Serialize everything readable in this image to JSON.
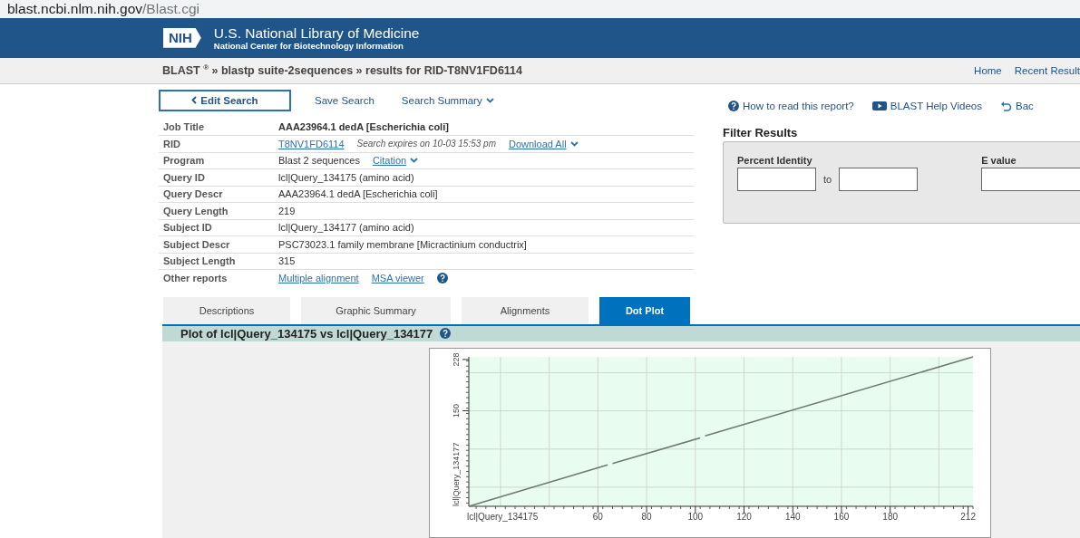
{
  "address_bar": {
    "host": "blast.ncbi.nlm.nih.gov",
    "path": "/Blast.cgi"
  },
  "banner": {
    "logo": "NIH",
    "title": "U.S. National Library of Medicine",
    "subtitle": "National Center for Biotechnology Information"
  },
  "breadcrumb": "BLAST $^{®}$ » blastp suite-2sequences » results for RID-T8NV1FD6114",
  "nav_links": [
    "Home",
    "Recent Result"
  ],
  "actions": [
    {
      "label": "Edit Search",
      "kind": "primary"
    },
    {
      "label": "Save Search",
      "kind": "link"
    },
    {
      "label": "Search Summary",
      "kind": "dropdown"
    }
  ],
  "help_links": [
    {
      "label": "How to read this report?",
      "kind": "help"
    },
    {
      "label": "BLAST Help Videos",
      "kind": "video"
    },
    {
      "label": "Bac",
      "kind": "back"
    }
  ],
  "summary": [
    {
      "label": "Job Title",
      "cells": [
        {
          "text": "AAA23964.1 dedA [Escherichia coli]",
          "kind": "bold"
        }
      ]
    },
    {
      "label": "RID",
      "cells": [
        {
          "text": "T8NV1FD6114",
          "kind": "link"
        },
        {
          "text": "Search expires on 10-03 15:53 pm",
          "kind": "note"
        },
        {
          "text": "Download All",
          "kind": "dropdown"
        }
      ]
    },
    {
      "label": "Program",
      "cells": [
        {
          "text": "Blast 2 sequences",
          "kind": "text"
        },
        {
          "text": "Citation",
          "kind": "dropdown"
        }
      ]
    },
    {
      "label": "Query ID",
      "cells": [
        {
          "text": "lcl|Query_134175 (amino acid)",
          "kind": "text"
        }
      ]
    },
    {
      "label": "Query Descr",
      "cells": [
        {
          "text": "AAA23964.1 dedA [Escherichia coli]",
          "kind": "text"
        }
      ]
    },
    {
      "label": "Query Length",
      "cells": [
        {
          "text": "219",
          "kind": "text"
        }
      ]
    },
    {
      "label": "Subject ID",
      "cells": [
        {
          "text": "lcl|Query_134177 (amino acid)",
          "kind": "text"
        }
      ]
    },
    {
      "label": "Subject Descr",
      "cells": [
        {
          "text": "PSC73023.1 family membrane [Micractinium conductrix]",
          "kind": "text"
        }
      ]
    },
    {
      "label": "Subject Length",
      "cells": [
        {
          "text": "315",
          "kind": "text"
        }
      ]
    },
    {
      "label": "Other reports",
      "cells": [
        {
          "text": "Multiple alignment",
          "kind": "link"
        },
        {
          "text": "MSA viewer",
          "kind": "link"
        },
        {
          "kind": "help"
        }
      ]
    }
  ],
  "filter": {
    "title": "Filter Results",
    "percent_identity": {
      "label": "Percent Identity",
      "joiner": "to"
    },
    "e_value": {
      "label": "E value"
    }
  },
  "tabs": [
    {
      "label": "Descriptions",
      "selected": false
    },
    {
      "label": "Graphic Summary",
      "selected": false
    },
    {
      "label": "Alignments",
      "selected": false
    },
    {
      "label": "Dot Plot",
      "selected": true
    }
  ],
  "plot": {
    "title": "Plot of lcl|Query_134175 vs lcl|Query_134177",
    "chart_data": {
      "type": "line",
      "xlabel": "lcl|Query_134175",
      "ylabel": "lcl|Query_134177",
      "series": [
        {
          "color": "#707a70",
          "x": [
            7,
            64
          ],
          "values": [
            5,
            68
          ]
        },
        {
          "color": "#707a70",
          "x": [
            66,
            102
          ],
          "values": [
            70,
            109
          ]
        },
        {
          "color": "#707a70",
          "x": [
            104,
            214
          ],
          "values": [
            112,
            232
          ]
        }
      ],
      "grid": true,
      "xlim": [
        7,
        214
      ],
      "ylim": [
        5,
        232
      ],
      "xticks": [
        60,
        80,
        100,
        120,
        140,
        160,
        180,
        212
      ],
      "yticks": [
        150,
        228
      ]
    }
  }
}
